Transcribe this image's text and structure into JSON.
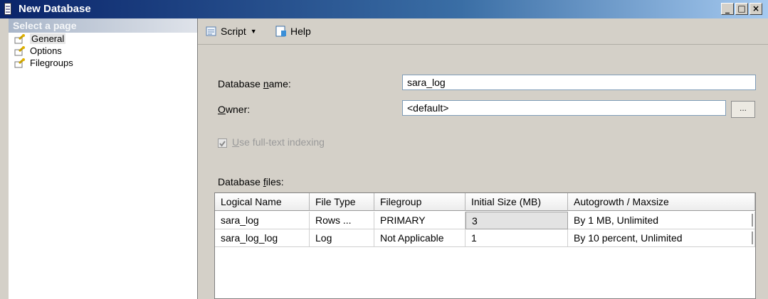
{
  "window": {
    "title": "New Database"
  },
  "sidebar": {
    "header": "Select a page",
    "items": [
      {
        "label": "General",
        "selected": true
      },
      {
        "label": "Options",
        "selected": false
      },
      {
        "label": "Filegroups",
        "selected": false
      }
    ]
  },
  "toolbar": {
    "script_label": "Script",
    "help_label": "Help"
  },
  "form": {
    "database_name_label_prefix": "Database ",
    "database_name_label_u": "n",
    "database_name_label_suffix": "ame:",
    "database_name_value": "sara_log",
    "owner_label_u": "O",
    "owner_label_suffix": "wner:",
    "owner_value": "<default>",
    "browse_label": "...",
    "fulltext_label_u": "U",
    "fulltext_label_suffix": "se full-text indexing",
    "fulltext_checked": true,
    "fulltext_enabled": false,
    "files_label_prefix": "Database ",
    "files_label_u": "f",
    "files_label_suffix": "iles:"
  },
  "files_table": {
    "columns": [
      "Logical Name",
      "File Type",
      "Filegroup",
      "Initial Size (MB)",
      "Autogrowth / Maxsize"
    ],
    "rows": [
      [
        "sara_log",
        "Rows ...",
        "PRIMARY",
        "3",
        "By 1 MB, Unlimited"
      ],
      [
        "sara_log_log",
        "Log",
        "Not Applicable",
        "1",
        "By 10 percent, Unlimited"
      ]
    ]
  },
  "colors": {
    "title_bar_start": "#0a246a",
    "title_bar_end": "#a6caf0",
    "dialog_bg": "#d4d0c8"
  },
  "icons": [
    "document-icon",
    "minimize-icon",
    "maximize-icon",
    "close-icon",
    "page-icon",
    "script-icon",
    "dropdown-arrow-icon",
    "help-icon"
  ]
}
